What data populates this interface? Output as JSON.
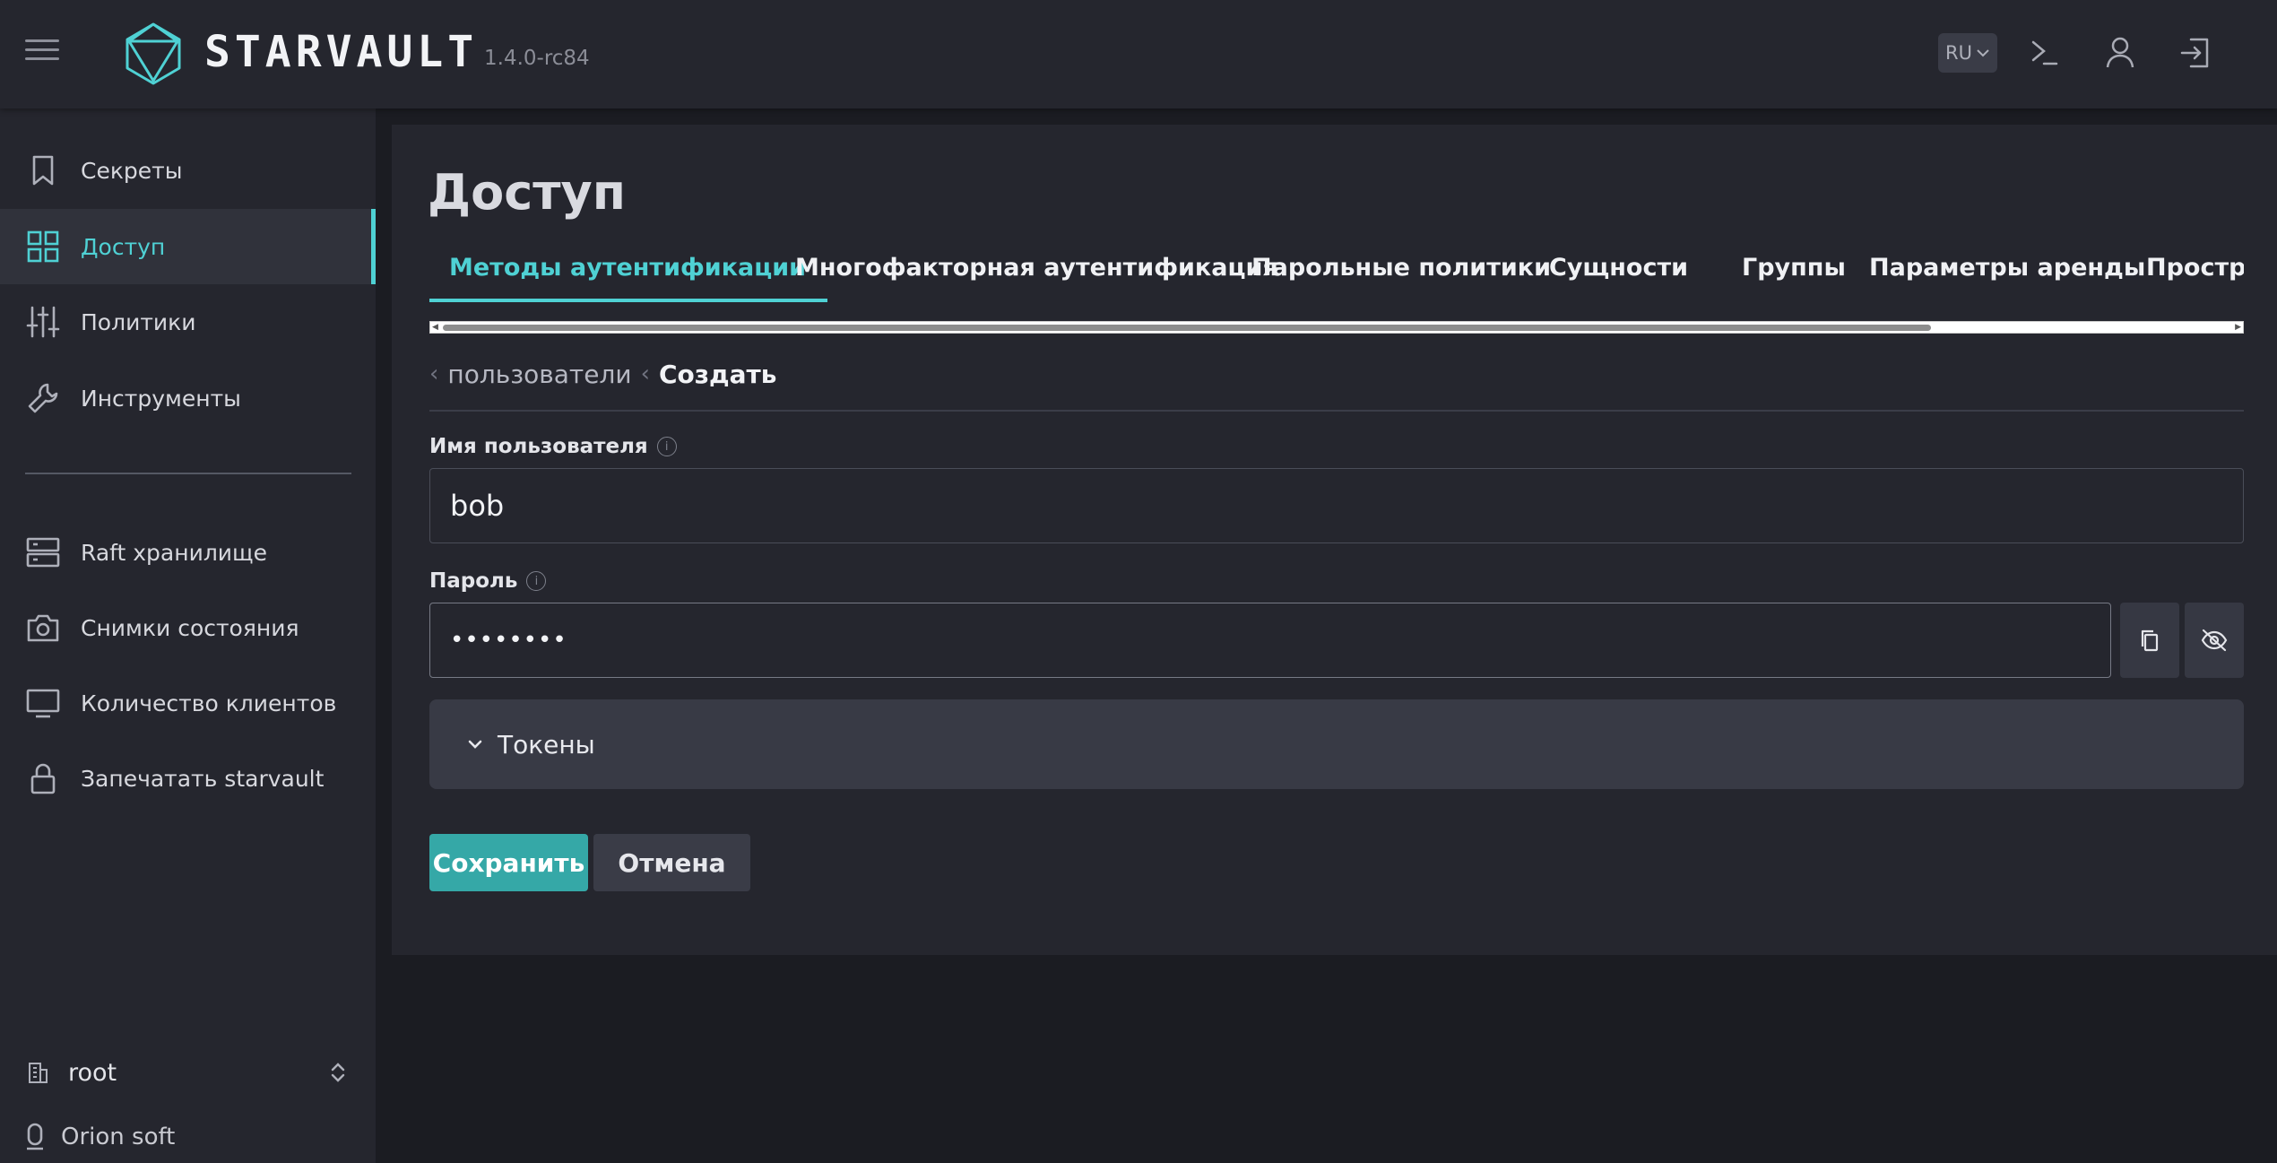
{
  "header": {
    "brand": "STARVAULT",
    "version": "1.4.0-rc84",
    "language": "RU"
  },
  "sidebar": {
    "items": [
      {
        "label": "Секреты",
        "icon": "bookmark-icon"
      },
      {
        "label": "Доступ",
        "icon": "grid-icon",
        "active": true
      },
      {
        "label": "Политики",
        "icon": "sliders-icon"
      },
      {
        "label": "Инструменты",
        "icon": "wrench-icon"
      }
    ],
    "items2": [
      {
        "label": "Raft хранилище",
        "icon": "server-icon"
      },
      {
        "label": "Снимки состояния",
        "icon": "camera-icon"
      },
      {
        "label": "Количество клиентов",
        "icon": "monitor-icon"
      },
      {
        "label": "Запечатать starvault",
        "icon": "lock-icon"
      }
    ],
    "namespace": "root",
    "organization": "Orion soft"
  },
  "main": {
    "title": "Доступ",
    "tabs": [
      {
        "label": "Методы аутентификации",
        "active": true
      },
      {
        "label": "Многофакторная аутентификация"
      },
      {
        "label": "Парольные политики"
      },
      {
        "label": "Сущности"
      },
      {
        "label": "Группы"
      },
      {
        "label": "Параметры аренды"
      },
      {
        "label": "Пространст"
      }
    ],
    "breadcrumb": {
      "parent": "пользователи",
      "current": "Создать"
    },
    "form": {
      "username_label": "Имя пользователя",
      "username_value": "bob",
      "password_label": "Пароль",
      "password_value": "••••••••",
      "tokens_label": "Токены",
      "save_label": "Сохранить",
      "cancel_label": "Отмена"
    }
  },
  "colors": {
    "accent": "#4fd1d4",
    "primary_button": "#35a8a7",
    "background": "#1b1c22",
    "panel": "#25262e"
  }
}
